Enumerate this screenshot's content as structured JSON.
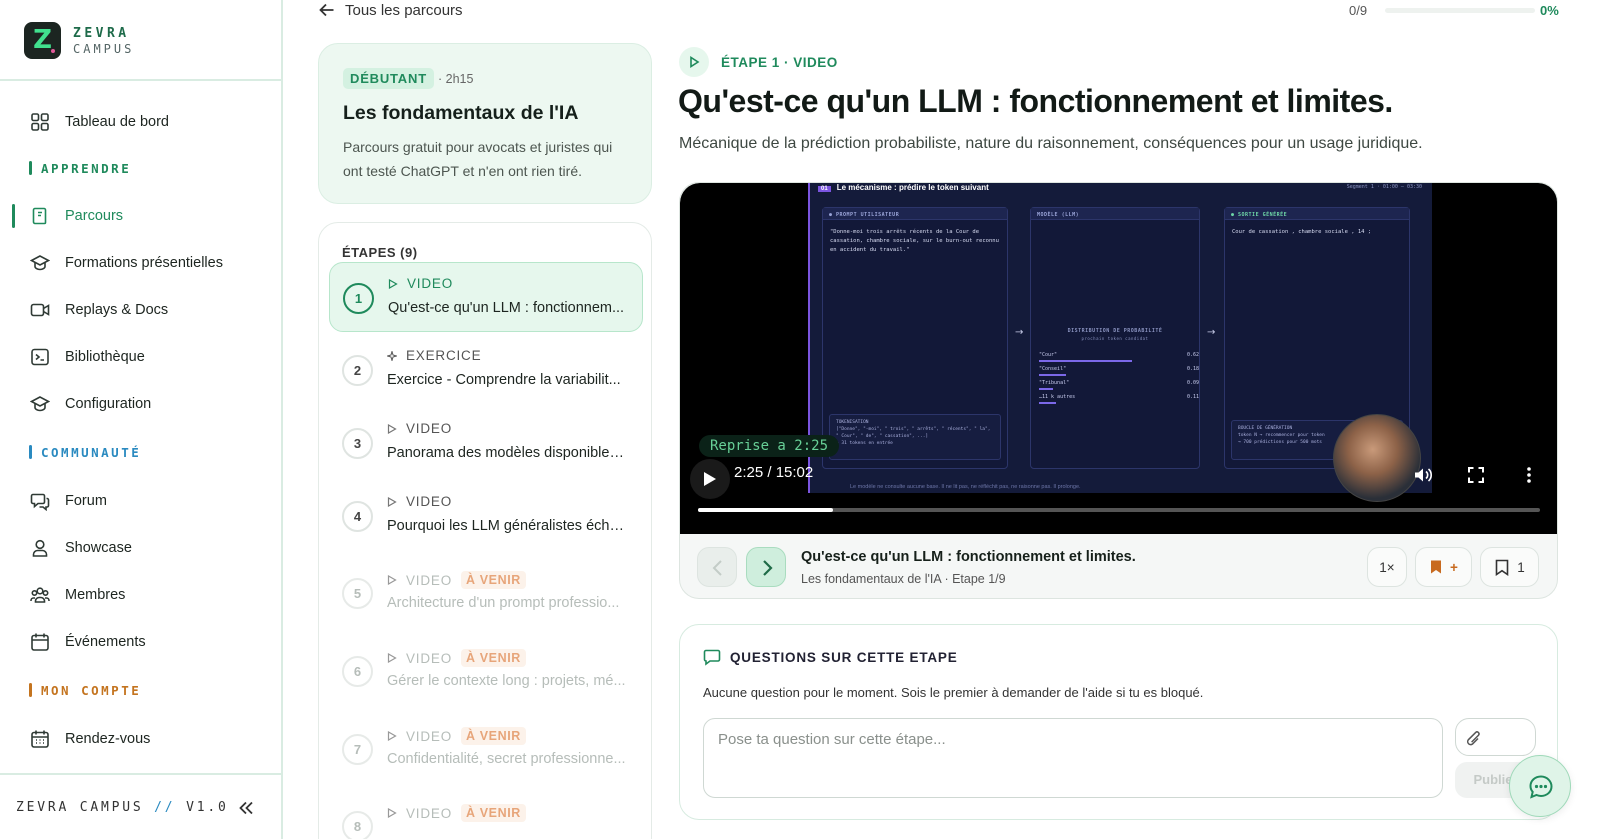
{
  "brand": {
    "logo_letter": "Z",
    "name": "ZEVRA",
    "sub": "CAMPUS"
  },
  "nav": {
    "dashboard": "Tableau de bord",
    "section_learn": "APPRENDRE",
    "parcours": "Parcours",
    "formations": "Formations présentielles",
    "replays": "Replays & Docs",
    "bibliotheque": "Bibliothèque",
    "configuration": "Configuration",
    "section_community": "COMMUNAUTÉ",
    "forum": "Forum",
    "showcase": "Showcase",
    "membres": "Membres",
    "evenements": "Événements",
    "section_account": "MON COMPTE",
    "rendezvous": "Rendez-vous",
    "footer_name": "ZEVRA CAMPUS",
    "footer_sep": "//",
    "footer_version": "V1.0"
  },
  "colors": {
    "accent": "#1f8a5c",
    "learn": "#1f8a5c",
    "community": "#2a8ac0",
    "account": "#c4741f",
    "soon": "#e0884e"
  },
  "topbar": {
    "back_label": "Tous les parcours",
    "progress_count": "0/9",
    "progress_pct": "0%",
    "progress_value": 0
  },
  "course": {
    "level": "DÉBUTANT",
    "duration": "· 2h15",
    "title": "Les fondamentaux de l'IA",
    "description": "Parcours gratuit pour avocats et juristes qui ont testé ChatGPT et n'en ont rien tiré."
  },
  "steps": {
    "title": "ÉTAPES (9)",
    "soon_label": "À VENIR",
    "items": [
      {
        "num": "1",
        "type": "VIDEO",
        "name": "Qu'est-ce qu'un LLM : fonctionnem..."
      },
      {
        "num": "2",
        "type": "EXERCICE",
        "name": "Exercice - Comprendre la variabilit..."
      },
      {
        "num": "3",
        "type": "VIDEO",
        "name": "Panorama des modèles disponibles ..."
      },
      {
        "num": "4",
        "type": "VIDEO",
        "name": "Pourquoi les LLM généralistes écho..."
      },
      {
        "num": "5",
        "type": "VIDEO",
        "name": "Architecture d'un prompt professio..."
      },
      {
        "num": "6",
        "type": "VIDEO",
        "name": "Gérer le contexte long : projets, mé..."
      },
      {
        "num": "7",
        "type": "VIDEO",
        "name": "Confidentialité, secret professionne..."
      },
      {
        "num": "8",
        "type": "VIDEO",
        "name": ""
      }
    ]
  },
  "main": {
    "step_label": "ÉTAPE 1 · VIDEO",
    "title": "Qu'est-ce qu'un LLM : fonctionnement et limites.",
    "subtitle": "Mécanique de la prédiction probabiliste, nature du raisonnement, conséquences pour un usage juridique."
  },
  "video": {
    "slide_title": "Le mécanisme : prédire le token suivant",
    "slide_badge": "01",
    "segment": "Segment 1 · 01:00 – 03:30",
    "pane1_head": "● PROMPT UTILISATEUR",
    "pane1_text": "\"Donne-moi trois arrêts récents de la Cour de cassation, chambre sociale, sur le burn-out reconnu en accident du travail.\"",
    "pane2_head": "MODÈLE (LLM)",
    "pane2_dist": "DISTRIBUTION DE PROBABILITÉ",
    "pane2_dist_sub": "prochain token candidat",
    "dist": [
      {
        "token": "\"Cour\"",
        "value": "0.62",
        "p": 0.62
      },
      {
        "token": "\"Conseil\"",
        "value": "0.18",
        "p": 0.18
      },
      {
        "token": "\"Tribunal\"",
        "value": "0.09",
        "p": 0.09
      },
      {
        "token": "…11 k autres",
        "value": "0.11",
        "p": 0.11
      }
    ],
    "pane3_head": "● SORTIE GÉNÉRÉE",
    "pane3_text": "Cour de cassation , chambre sociale , 14 ;",
    "token_box": "TOKENISATION\n[\"Donne\", \"-moi\", \" trois\", \" arrêts\", \" récents\", \" la\", \" Cour\", \" de\", \" cassation\", ...]\n≈ 31 tokens en entrée",
    "loop_box": "BOUCLE DE GÉNÉRATION\ntoken N → recommencer pour token\n→ 700 prédictions pour 500 mots",
    "caption": "Le modèle ne consulte aucune base. Il ne lit pas, ne réfléchit pas, ne raisonne pas. Il prolonge.",
    "resume_label": "Reprise a 2:25",
    "time": "2:25 / 15:02",
    "seek_progress": 0.16
  },
  "player_bar": {
    "title": "Qu'est-ce qu'un LLM : fonctionnement et limites.",
    "subtitle": "Les fondamentaux de l'IA · Etape 1/9",
    "speed": "1×",
    "bookmark_add": "+",
    "bookmark_count": "1"
  },
  "questions": {
    "title": "QUESTIONS SUR CETTE ETAPE",
    "empty": "Aucune question pour le moment. Sois le premier à demander de l'aide si tu es bloqué.",
    "placeholder": "Pose ta question sur cette étape...",
    "publish": "Publier"
  }
}
